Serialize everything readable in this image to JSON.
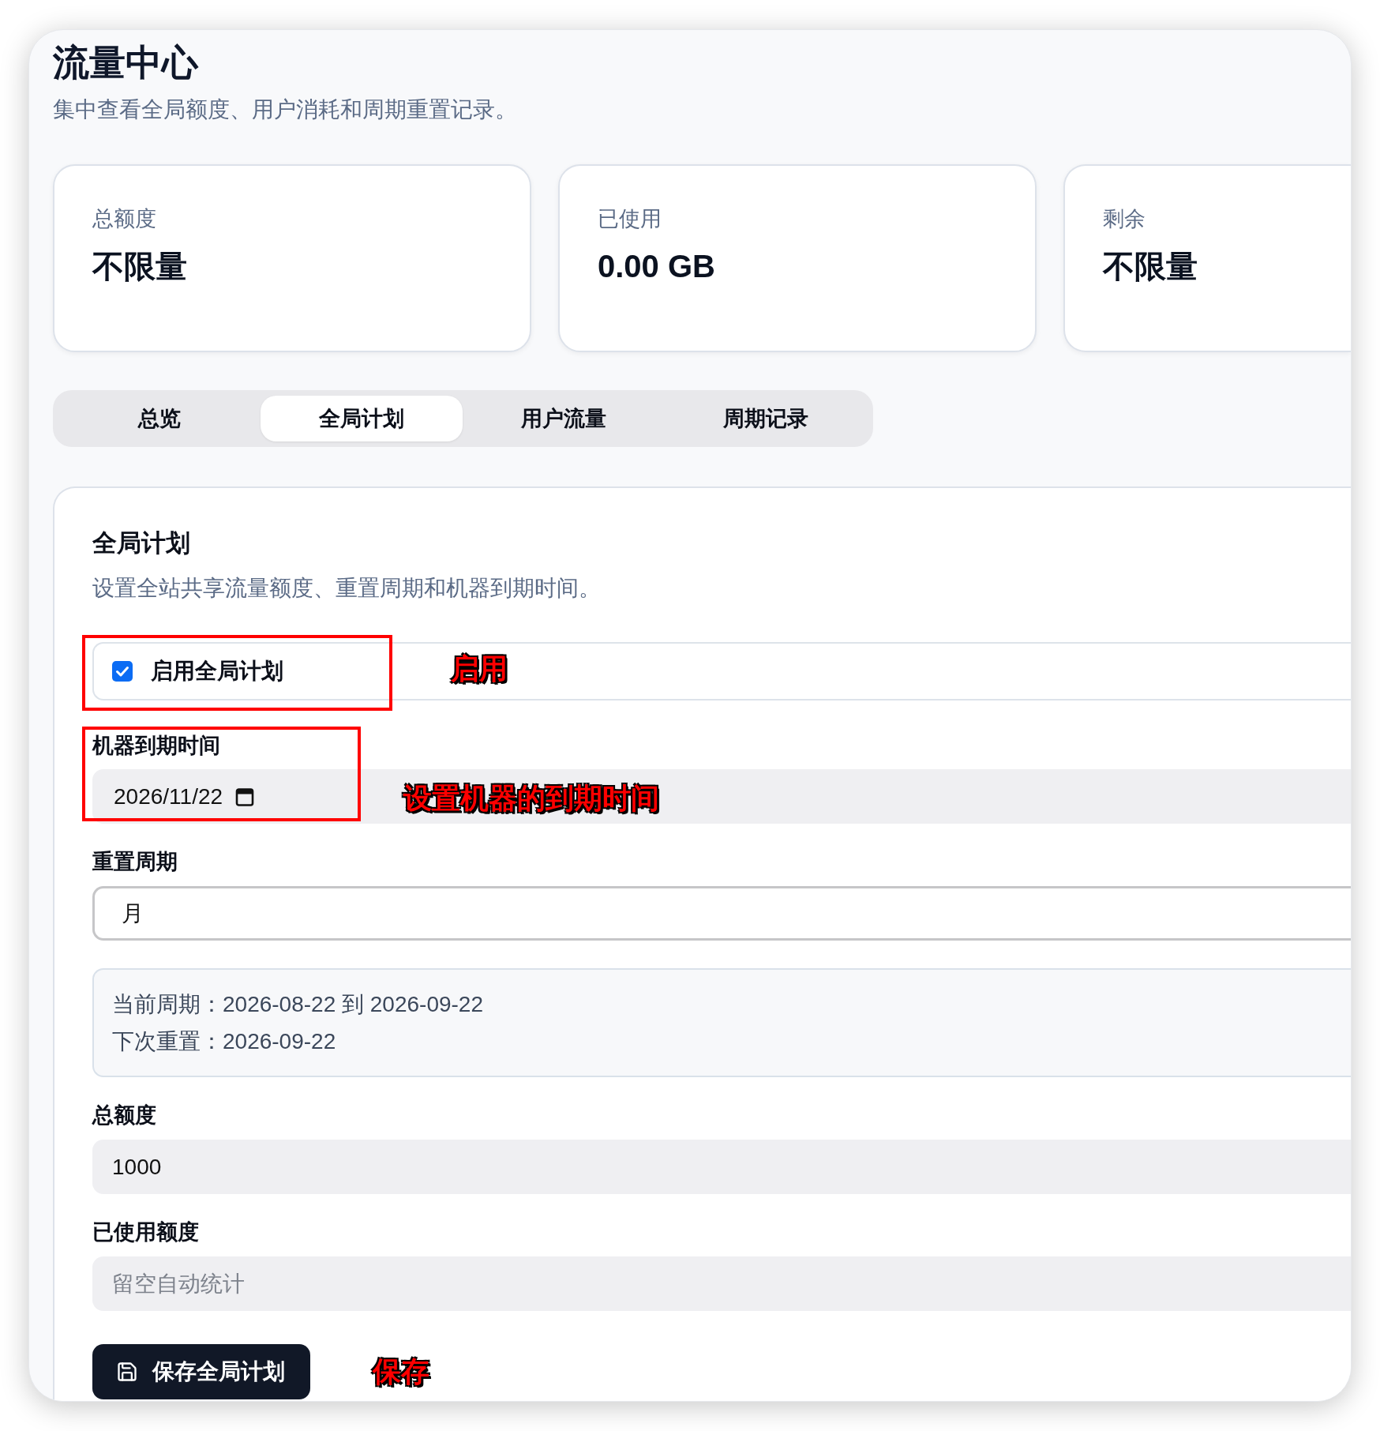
{
  "page": {
    "title": "流量中心",
    "subtitle": "集中查看全局额度、用户消耗和周期重置记录。"
  },
  "stats": [
    {
      "label": "总额度",
      "value": "不限量"
    },
    {
      "label": "已使用",
      "value": "0.00 GB"
    },
    {
      "label": "剩余",
      "value": "不限量"
    }
  ],
  "tabs": [
    {
      "label": "总览",
      "selected": false
    },
    {
      "label": "全局计划",
      "selected": true
    },
    {
      "label": "用户流量",
      "selected": false
    },
    {
      "label": "周期记录",
      "selected": false
    }
  ],
  "plan_card": {
    "title": "全局计划",
    "description": "设置全站共享流量额度、重置周期和机器到期时间。",
    "enable": {
      "label": "启用全局计划",
      "checked": true,
      "highlighted": true,
      "annotation": "启用"
    },
    "fields": [
      {
        "kind": "date",
        "label": "机器到期时间",
        "value": "2026/11/22",
        "highlighted": true,
        "annotation": "设置机器的到期时间"
      },
      {
        "kind": "select",
        "label": "重置周期",
        "value": "月"
      },
      {
        "kind": "info",
        "lines": [
          "当前周期：2026-08-22 到 2026-09-22",
          "下次重置：2026-09-22"
        ]
      },
      {
        "kind": "input",
        "label": "总额度",
        "value": "1000"
      },
      {
        "kind": "input",
        "label": "已使用额度",
        "placeholder": "留空自动统计"
      }
    ],
    "save_button": {
      "label": "保存全局计划",
      "annotation": "保存"
    }
  }
}
